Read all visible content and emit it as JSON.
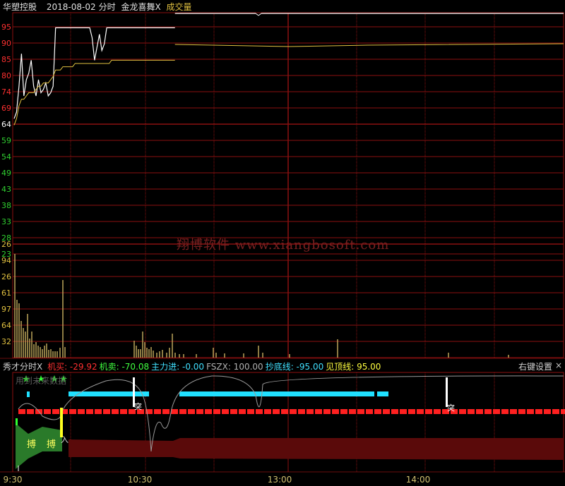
{
  "title_bar": {
    "stock_name": "华塑控股",
    "date": "2018-08-02",
    "chart_kind": "分时",
    "indicator": "金龙喜舞X",
    "volume_label": "成交量"
  },
  "indicator_bar": {
    "name": "秀才分时X",
    "items": [
      {
        "label": "机买:",
        "value": "-29.92",
        "color": "#ff3030"
      },
      {
        "label": "机卖:",
        "value": "-70.08",
        "color": "#40ff40"
      },
      {
        "label": "主力进:",
        "value": "-0.00",
        "color": "#40e0ff"
      },
      {
        "label": "FSZX:",
        "value": "100.00",
        "color": "#b0b0b0"
      },
      {
        "label": "抄底线:",
        "value": "-95.00",
        "color": "#40e0ff"
      },
      {
        "label": "见顶线:",
        "value": "95.00",
        "color": "#ffff40"
      }
    ],
    "settings_label": "右键设置",
    "close_label": "×",
    "no_data_text": "用到未来数据"
  },
  "price_axis": [
    "95",
    "90",
    "85",
    "80",
    "74",
    "69",
    "64",
    "59",
    "54",
    "49",
    "43",
    "38",
    "33",
    "28",
    "23"
  ],
  "price_axis_colors": {
    "up": "#ff3030",
    "flat": "#ffffff",
    "down": "#30d030"
  },
  "volume_axis": [
    "26",
    "94",
    "26",
    "61",
    "97",
    "64",
    "32"
  ],
  "time_axis": [
    "9:30",
    "10:30",
    "13:00",
    "14:00"
  ],
  "watermark": "翔博软件 www.xiangbosoft.com",
  "markers": {
    "bo": "搏",
    "tu": "突",
    "ru": "入"
  },
  "colors": {
    "grid": "#8b1010",
    "price_line": "#ffffff",
    "avg_line": "#e0c040",
    "volume_bar": "#c8b060",
    "cyan_band": "#20e0ff",
    "red_band": "#ff2020",
    "dark_red_area": "#5a0a0a",
    "green_area": "#2a7a2a"
  },
  "chart_data": {
    "type": "line",
    "series": [
      {
        "name": "price",
        "values": [
          68,
          70,
          78,
          88,
          75,
          80,
          82,
          86,
          78,
          75,
          80,
          76,
          77,
          79,
          75,
          76,
          78,
          96,
          96,
          96,
          96,
          96,
          96,
          96,
          96,
          96,
          96,
          96,
          96,
          96,
          96,
          96,
          93,
          86,
          90,
          94,
          89,
          91,
          96,
          96,
          96,
          96,
          96,
          96,
          96,
          96,
          96,
          96,
          96,
          96,
          96,
          96,
          96,
          96,
          96,
          96,
          96,
          96,
          96,
          96,
          96,
          96,
          96,
          96,
          96,
          96,
          96
        ]
      },
      {
        "name": "avg",
        "values": [
          66,
          68,
          72,
          74,
          74,
          75,
          76,
          76,
          76,
          77,
          78,
          78,
          79,
          79,
          79,
          80,
          81,
          83,
          83,
          83,
          84,
          84,
          84,
          84,
          84,
          85,
          85,
          85,
          85,
          85,
          85,
          85,
          85,
          85,
          85,
          85,
          85,
          85,
          85,
          85,
          86,
          86,
          86,
          86,
          86,
          86,
          86,
          86,
          86,
          86,
          86,
          86,
          86,
          86,
          86,
          86,
          86,
          86,
          86,
          86,
          86,
          86,
          86,
          86,
          86,
          86,
          86
        ]
      }
    ]
  }
}
